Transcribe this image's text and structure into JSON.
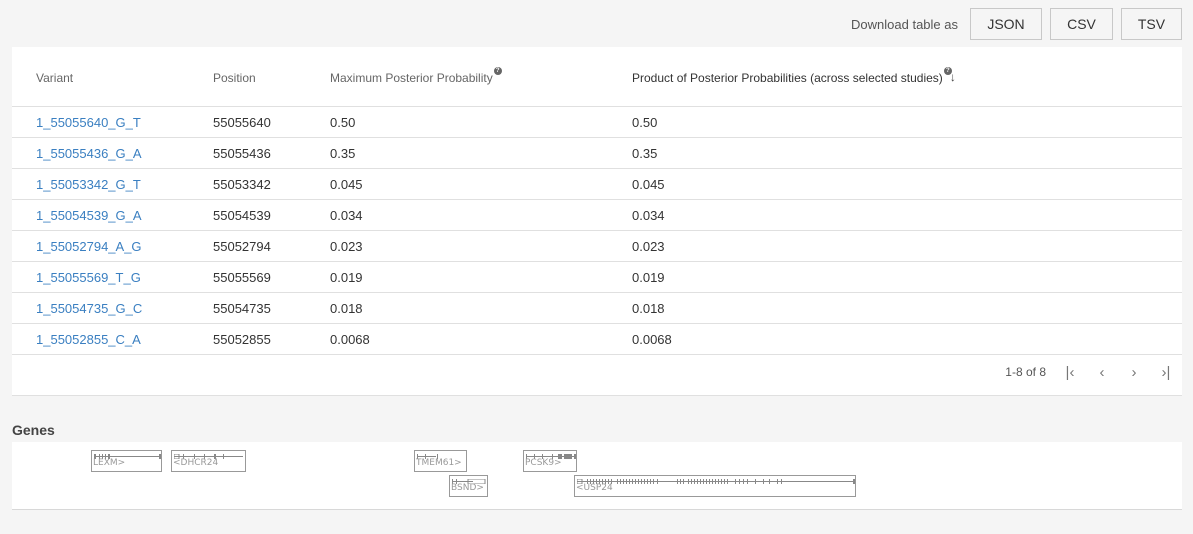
{
  "download": {
    "label": "Download table as",
    "buttons": [
      "JSON",
      "CSV",
      "TSV"
    ]
  },
  "table": {
    "columns": [
      "Variant",
      "Position",
      "Maximum Posterior Probability",
      "Product of Posterior Probabilities (across selected studies)"
    ],
    "help_glyph": "?",
    "sort_glyph": "↓",
    "rows": [
      {
        "variant": "1_55055640_G_T",
        "position": "55055640",
        "max_pp": "0.50",
        "prod_pp": "0.50"
      },
      {
        "variant": "1_55055436_G_A",
        "position": "55055436",
        "max_pp": "0.35",
        "prod_pp": "0.35"
      },
      {
        "variant": "1_55053342_G_T",
        "position": "55053342",
        "max_pp": "0.045",
        "prod_pp": "0.045"
      },
      {
        "variant": "1_55054539_G_A",
        "position": "55054539",
        "max_pp": "0.034",
        "prod_pp": "0.034"
      },
      {
        "variant": "1_55052794_A_G",
        "position": "55052794",
        "max_pp": "0.023",
        "prod_pp": "0.023"
      },
      {
        "variant": "1_55055569_T_G",
        "position": "55055569",
        "max_pp": "0.019",
        "prod_pp": "0.019"
      },
      {
        "variant": "1_55054735_G_C",
        "position": "55054735",
        "max_pp": "0.018",
        "prod_pp": "0.018"
      },
      {
        "variant": "1_55052855_C_A",
        "position": "55052855",
        "max_pp": "0.0068",
        "prod_pp": "0.0068"
      }
    ]
  },
  "pagination": {
    "range_text": "1-8 of 8",
    "first_glyph": "|‹",
    "prev_glyph": "‹",
    "next_glyph": "›",
    "last_glyph": "›|"
  },
  "genes": {
    "title": "Genes",
    "items": [
      "LEXM>",
      "<DHCR24",
      "TMEM61>",
      "BSND>",
      "PCSK9>",
      "<USP24"
    ]
  },
  "colors": {
    "link": "#3a7fc1",
    "background": "#f5f5f5",
    "card": "#ffffff",
    "gene_outline": "#999999"
  }
}
